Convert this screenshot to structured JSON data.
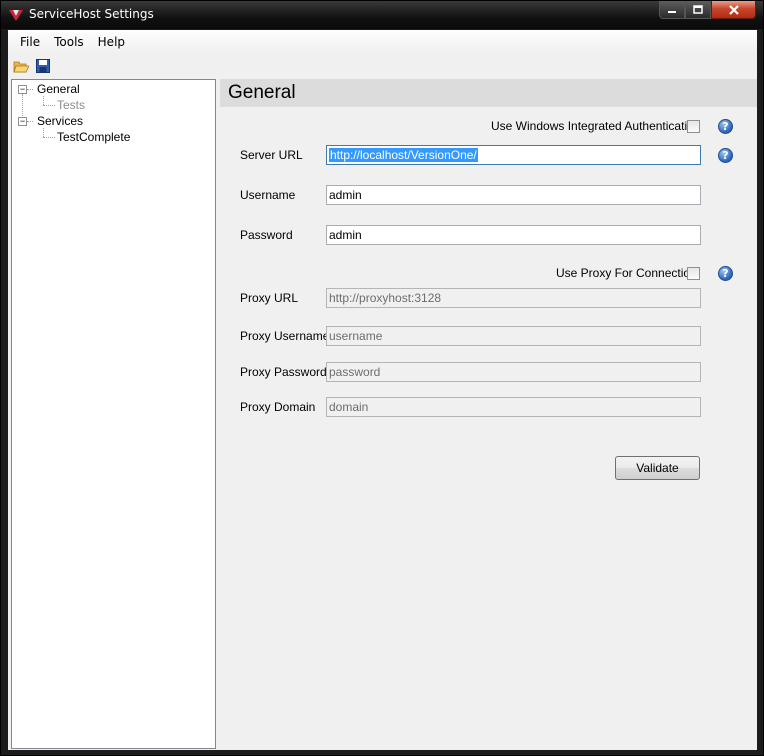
{
  "window": {
    "title": "ServiceHost Settings"
  },
  "menu": {
    "items": [
      "File",
      "Tools",
      "Help"
    ]
  },
  "toolbar": {
    "open_icon": "folder-open-icon",
    "save_icon": "save-icon"
  },
  "tree": {
    "nodes": [
      {
        "label": "General",
        "children": [
          {
            "label": "Tests",
            "enabled": false
          }
        ]
      },
      {
        "label": "Services",
        "children": [
          {
            "label": "TestComplete",
            "enabled": true
          }
        ]
      }
    ]
  },
  "section": {
    "title": "General"
  },
  "form": {
    "windows_auth_label": "Use Windows Integrated Authentication",
    "windows_auth_checked": false,
    "server_url_label": "Server URL",
    "server_url_value": "http://localhost/VersionOne/",
    "username_label": "Username",
    "username_value": "admin",
    "password_label": "Password",
    "password_value": "admin",
    "use_proxy_label": "Use Proxy For Connection",
    "use_proxy_checked": false,
    "proxy_url_label": "Proxy URL",
    "proxy_url_value": "http://proxyhost:3128",
    "proxy_username_label": "Proxy Username",
    "proxy_username_value": "username",
    "proxy_password_label": "Proxy Password",
    "proxy_password_value": "password",
    "proxy_domain_label": "Proxy Domain",
    "proxy_domain_value": "domain",
    "validate_label": "Validate",
    "help_glyph": "?"
  },
  "colors": {
    "help_icon": "#2a63b8",
    "selection": "#3399ff",
    "close_button": "#c6462c"
  }
}
